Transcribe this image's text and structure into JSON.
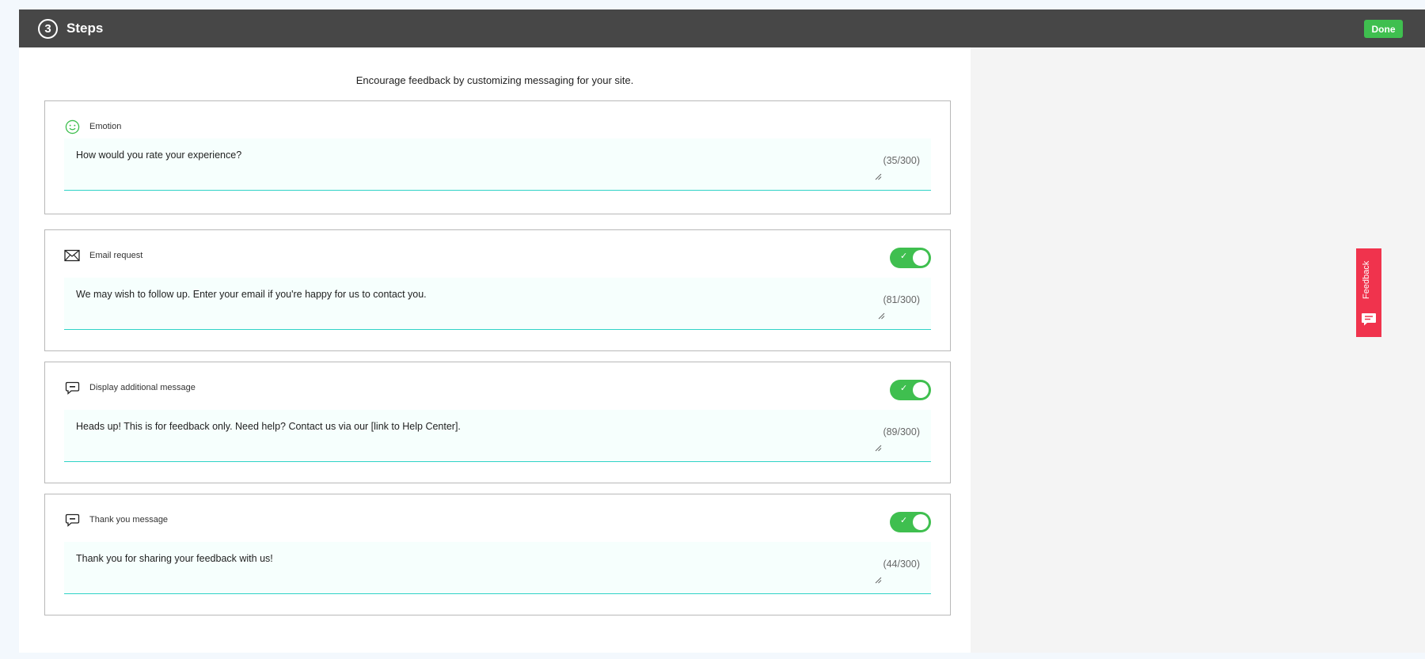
{
  "header": {
    "step_number": "3",
    "title": "Steps",
    "done_label": "Done"
  },
  "intro": "Encourage feedback by customizing messaging for your site.",
  "cards": [
    {
      "label": "Emotion",
      "icon": "smiley-icon",
      "has_toggle": false,
      "text": "How would you rate your experience?",
      "counter": "(35/300)"
    },
    {
      "label": "Email request",
      "icon": "envelope-icon",
      "has_toggle": true,
      "toggle_on": true,
      "text": "We may wish to follow up. Enter your email if you're happy for us to contact you.",
      "counter": "(81/300)"
    },
    {
      "label": "Display additional message",
      "icon": "chat-bubble-icon",
      "has_toggle": true,
      "toggle_on": true,
      "text": "Heads up! This is for feedback only. Need help? Contact us via our [link to Help Center].",
      "counter": "(89/300)"
    },
    {
      "label": "Thank you message",
      "icon": "chat-bubble-icon",
      "has_toggle": true,
      "toggle_on": true,
      "text": "Thank you for sharing your feedback with us!",
      "counter": "(44/300)"
    }
  ],
  "feedback_tab": {
    "label": "Feedback",
    "icon": "chat-icon"
  },
  "colors": {
    "topbar": "#474747",
    "accent_green": "#3fbf4f",
    "field_border": "#2fd3c7",
    "feedback_red": "#f0334d"
  }
}
